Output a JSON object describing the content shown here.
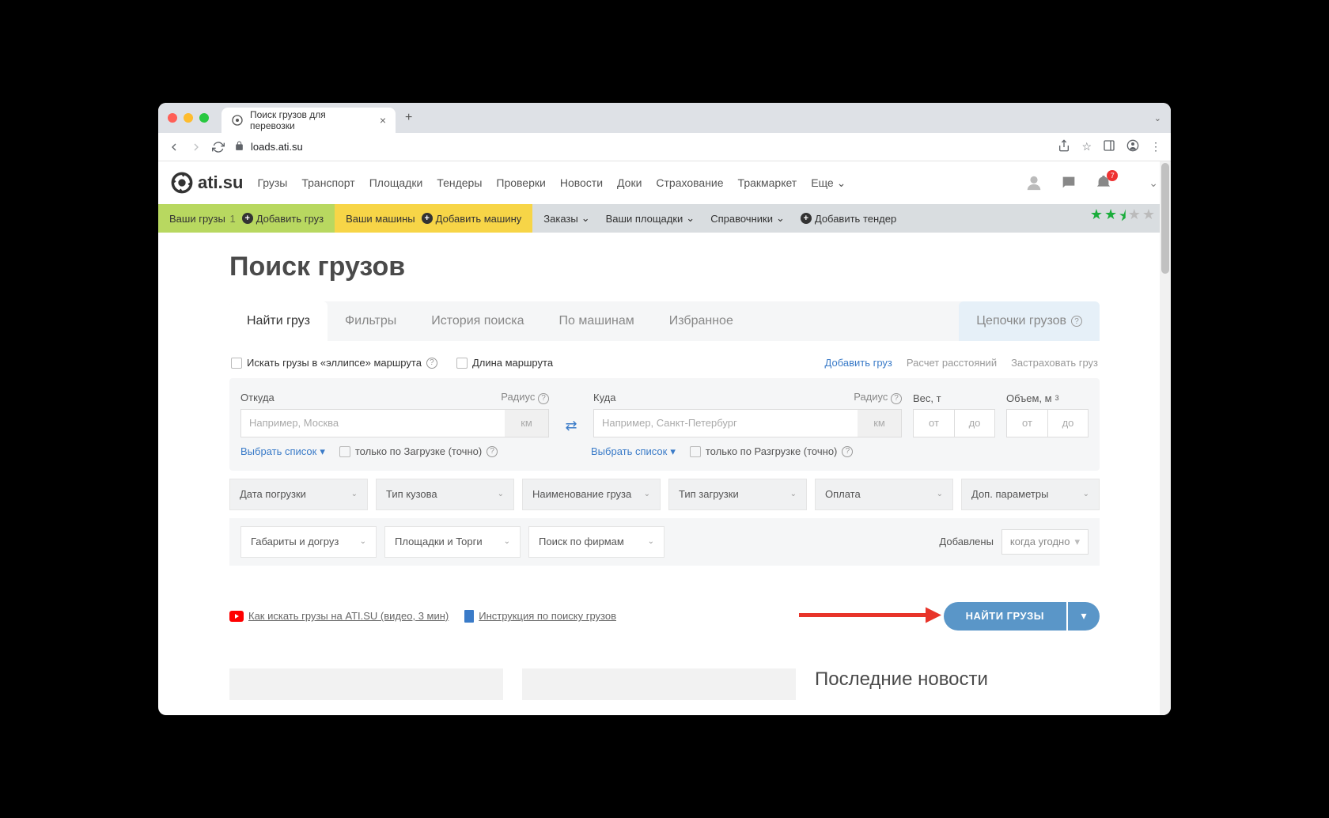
{
  "browser": {
    "tab_title": "Поиск грузов для перевозки",
    "url": "loads.ati.su"
  },
  "logo_text": "ati.su",
  "main_nav": [
    "Грузы",
    "Транспорт",
    "Площадки",
    "Тендеры",
    "Проверки",
    "Новости",
    "Доки",
    "Страхование",
    "Тракмаркет"
  ],
  "more_label": "Еще",
  "notif_badge": "7",
  "subbar": {
    "your_loads": "Ваши грузы",
    "your_loads_count": "1",
    "add_load": "Добавить груз",
    "your_trucks": "Ваши машины",
    "add_truck": "Добавить машину",
    "orders": "Заказы",
    "your_sites": "Ваши площадки",
    "dirs": "Справочники",
    "add_tender": "Добавить тендер"
  },
  "page_title": "Поиск грузов",
  "search_tabs": {
    "find": "Найти груз",
    "filters": "Фильтры",
    "history": "История поиска",
    "by_truck": "По машинам",
    "fav": "Избранное",
    "chains": "Цепочки грузов"
  },
  "checks": {
    "ellipse": "Искать грузы в «эллипсе» маршрута",
    "route_len": "Длина маршрута"
  },
  "quick_links": {
    "add_load": "Добавить груз",
    "calc": "Расчет расстояний",
    "insure": "Застраховать груз"
  },
  "labels": {
    "from": "Откуда",
    "radius": "Радиус",
    "to": "Куда",
    "weight": "Вес, т",
    "volume_html": "Объем, м",
    "km": "км",
    "from_ph": "Например, Москва",
    "to_ph": "Например, Санкт-Петербург",
    "w_from": "от",
    "w_to": "до",
    "select_list": "Выбрать список",
    "only_load": "только по Загрузке (точно)",
    "only_unload": "только по Разгрузке (точно)"
  },
  "filters1": [
    "Дата погрузки",
    "Тип кузова",
    "Наименование груза",
    "Тип загрузки",
    "Оплата",
    "Доп. параметры"
  ],
  "filters2": [
    "Габариты и догруз",
    "Площадки и Торги",
    "Поиск по фирмам"
  ],
  "added_label": "Добавлены",
  "anytime": "когда угодно",
  "help": {
    "video": "Как искать грузы на ATI.SU (видео, 3 мин)",
    "guide": "Инструкция по поиску грузов"
  },
  "search_button": "НАЙТИ ГРУЗЫ",
  "news_title": "Последние новости"
}
